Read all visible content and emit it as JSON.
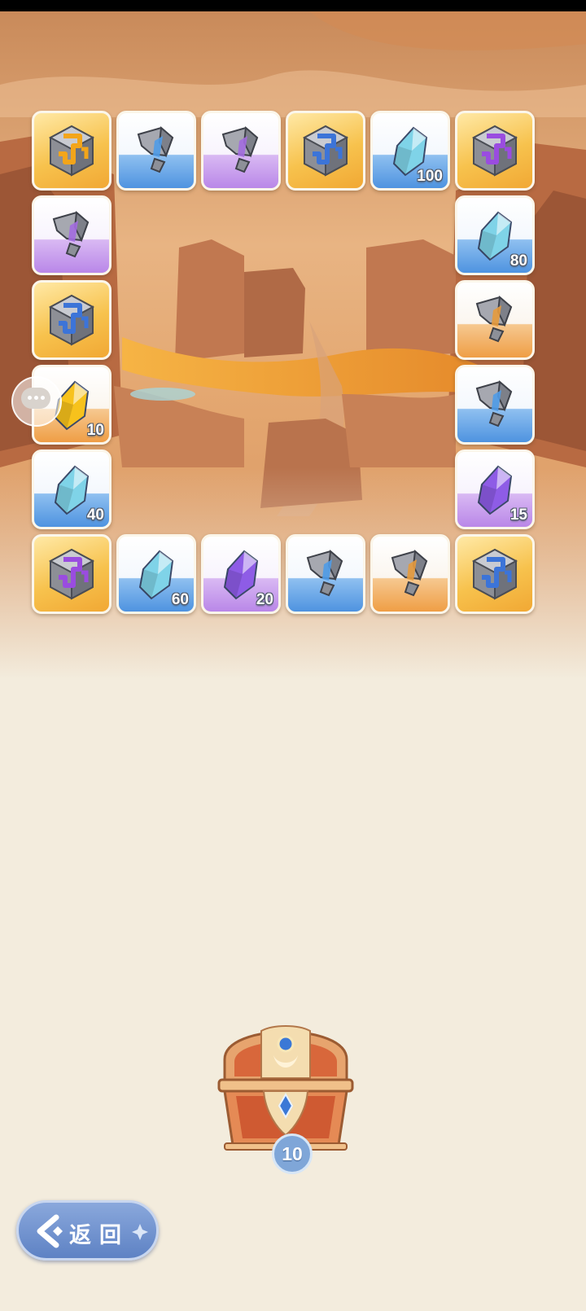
{
  "board": {
    "tiles": [
      {
        "type": "cube",
        "bg": "gold",
        "accent": "#f3a51a",
        "qty": null
      },
      {
        "type": "shard",
        "bg": "blue",
        "accent": "#4f9be8",
        "qty": null
      },
      {
        "type": "shard",
        "bg": "purple",
        "accent": "#a36be0",
        "qty": null
      },
      {
        "type": "cube",
        "bg": "gold",
        "accent": "#3c74d8",
        "qty": null
      },
      {
        "type": "crystal",
        "bg": "blue",
        "accent": "#7fd3e8",
        "qty": "100"
      },
      {
        "type": "cube",
        "bg": "gold",
        "accent": "#9a4ce0",
        "qty": null
      },
      {
        "type": "shard",
        "bg": "purple",
        "accent": "#a36be0",
        "qty": null
      },
      {
        "type": "crystal",
        "bg": "blue",
        "accent": "#7fd3e8",
        "qty": "80"
      },
      {
        "type": "cube",
        "bg": "gold",
        "accent": "#3c74d8",
        "qty": null
      },
      {
        "type": "shard",
        "bg": "orange",
        "accent": "#e79a3c",
        "qty": null
      },
      {
        "type": "crystal",
        "bg": "orange",
        "accent": "#f7c21c",
        "qty": "10"
      },
      {
        "type": "shard",
        "bg": "blue",
        "accent": "#4f9be8",
        "qty": null
      },
      {
        "type": "crystal",
        "bg": "blue",
        "accent": "#7fd3e8",
        "qty": "40"
      },
      {
        "type": "crystal",
        "bg": "purple",
        "accent": "#8e5ce6",
        "qty": "15"
      },
      {
        "type": "cube",
        "bg": "gold",
        "accent": "#9a4ce0",
        "qty": null
      },
      {
        "type": "crystal",
        "bg": "blue",
        "accent": "#7fd3e8",
        "qty": "60"
      },
      {
        "type": "crystal",
        "bg": "purple",
        "accent": "#8e5ce6",
        "qty": "20"
      },
      {
        "type": "shard",
        "bg": "blue",
        "accent": "#4f9be8",
        "qty": null
      },
      {
        "type": "shard",
        "bg": "orange",
        "accent": "#e79a3c",
        "qty": null
      },
      {
        "type": "cube",
        "bg": "gold",
        "accent": "#3c74d8",
        "qty": null
      }
    ]
  },
  "chat": {
    "icon": "chat-bubble-icon"
  },
  "chest": {
    "icon": "treasure-chest-icon",
    "count": "10"
  },
  "back_button": {
    "label": "返回",
    "icon": "back-arrow-icon"
  },
  "colors": {
    "background": "#f3ecdd",
    "button": "#6b8cc9",
    "lava": "#f0a43a"
  }
}
